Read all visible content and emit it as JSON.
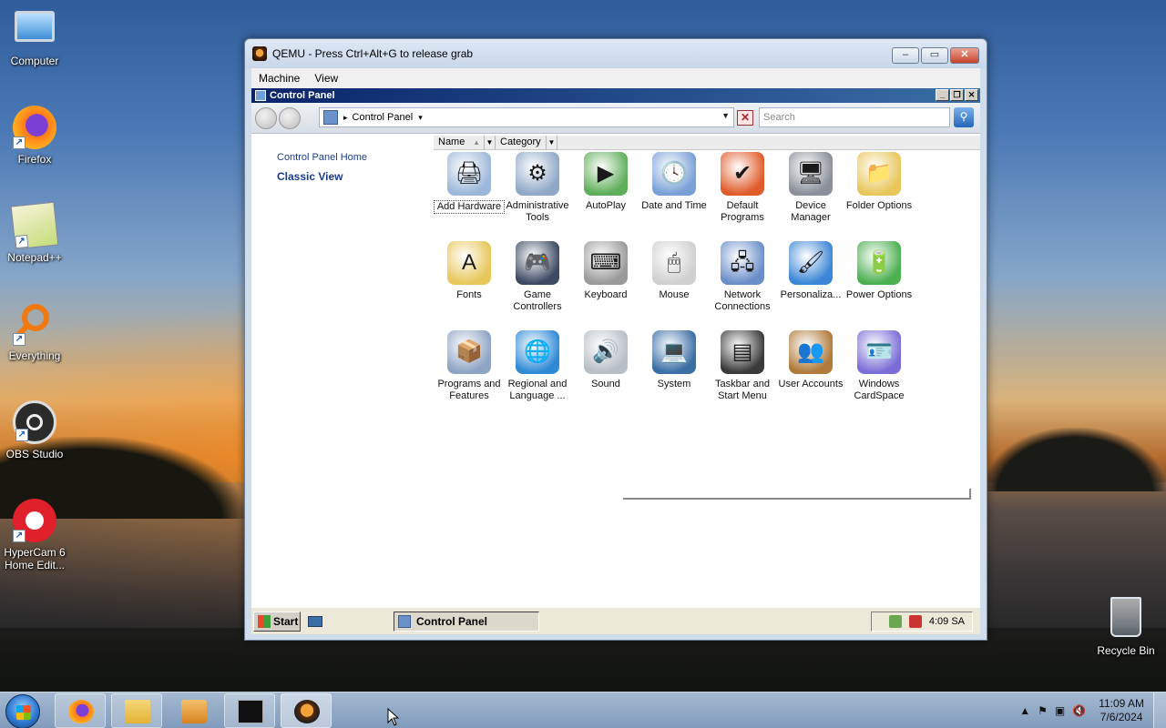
{
  "desktop": {
    "icons": [
      {
        "label": "Computer",
        "glyph": "🖥",
        "shortcut": ""
      },
      {
        "label": "Firefox",
        "glyph": "🦊",
        "shortcut": "↗"
      },
      {
        "label": "Notepad++",
        "glyph": "📝",
        "shortcut": "↗"
      },
      {
        "label": "Everything",
        "glyph": "🔍",
        "shortcut": "↗"
      },
      {
        "label": "OBS Studio",
        "glyph": "⏺",
        "shortcut": "↗"
      },
      {
        "label": "HyperCam 6 Home Edit...",
        "glyph": "●",
        "shortcut": "↗"
      }
    ],
    "recycle_bin": {
      "label": "Recycle Bin",
      "glyph": "🗑"
    }
  },
  "qemu": {
    "title": "QEMU - Press Ctrl+Alt+G to release grab",
    "menu": [
      "Machine",
      "View"
    ],
    "buttons": {
      "minimize": "–",
      "maximize": "▭",
      "close": "✕"
    }
  },
  "control_panel": {
    "title": "Control Panel",
    "title_buttons": {
      "minimize": "_",
      "restore": "❐",
      "close": "✕"
    },
    "address": "Control Panel",
    "search_placeholder": "Search",
    "left_pane": {
      "home": "Control Panel Home",
      "classic": "Classic View"
    },
    "columns": [
      "Name",
      "Category"
    ],
    "items": [
      {
        "label": "Add Hardware",
        "glyph": "🖨",
        "selected": true
      },
      {
        "label": "Administrative Tools",
        "glyph": "⚙"
      },
      {
        "label": "AutoPlay",
        "glyph": "▶"
      },
      {
        "label": "Date and Time",
        "glyph": "🕓"
      },
      {
        "label": "Default Programs",
        "glyph": "✔"
      },
      {
        "label": "Device Manager",
        "glyph": "🖥"
      },
      {
        "label": "Folder Options",
        "glyph": "📁"
      },
      {
        "label": "Fonts",
        "glyph": "A"
      },
      {
        "label": "Game Controllers",
        "glyph": "🎮"
      },
      {
        "label": "Keyboard",
        "glyph": "⌨"
      },
      {
        "label": "Mouse",
        "glyph": "🖱"
      },
      {
        "label": "Network Connections",
        "glyph": "🖧"
      },
      {
        "label": "Personaliza...",
        "glyph": "🖌"
      },
      {
        "label": "Power Options",
        "glyph": "🔋"
      },
      {
        "label": "Programs and Features",
        "glyph": "📦"
      },
      {
        "label": "Regional and Language ...",
        "glyph": "🌐"
      },
      {
        "label": "Sound",
        "glyph": "🔊"
      },
      {
        "label": "System",
        "glyph": "💻"
      },
      {
        "label": "Taskbar and Start Menu",
        "glyph": "▤"
      },
      {
        "label": "User Accounts",
        "glyph": "👥"
      },
      {
        "label": "Windows CardSpace",
        "glyph": "🪪"
      }
    ]
  },
  "guest_taskbar": {
    "start": "Start",
    "task": "Control Panel",
    "clock": "4:09 SA"
  },
  "host_taskbar": {
    "pinned": [
      "firefox",
      "file-explorer",
      "media-player",
      "command-prompt",
      "qemu"
    ],
    "clock_time": "11:09 AM",
    "clock_date": "7/6/2024",
    "tray_arrow": "▲",
    "tray_icons": [
      "⚑",
      "▣",
      "🔇"
    ]
  }
}
